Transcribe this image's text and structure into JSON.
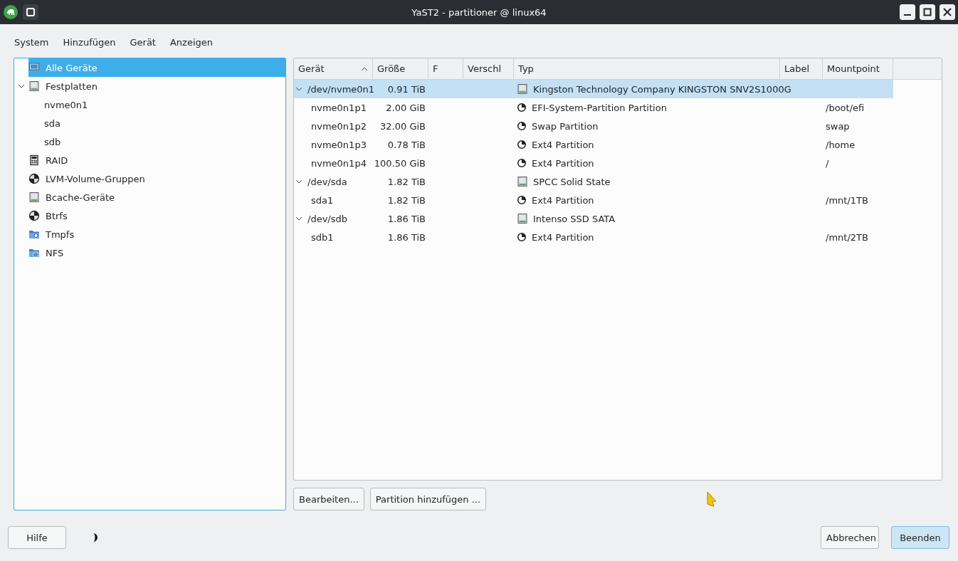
{
  "window": {
    "title": "YaST2 - partitioner @ linux64"
  },
  "menu": [
    "System",
    "Hinzufügen",
    "Gerät",
    "Anzeigen"
  ],
  "sidebar": {
    "items": [
      {
        "label": "Alle Geräte",
        "kind": "monitor",
        "selected": true
      },
      {
        "label": "Festplatten",
        "kind": "disk",
        "selected": false,
        "expanded": true,
        "children": [
          {
            "label": "nvme0n1",
            "selected": false
          },
          {
            "label": "sda",
            "selected": false
          },
          {
            "label": "sdb",
            "selected": false
          }
        ]
      },
      {
        "label": "RAID",
        "kind": "raid",
        "selected": false
      },
      {
        "label": "LVM-Volume-Gruppen",
        "kind": "pie",
        "selected": false
      },
      {
        "label": "Bcache-Geräte",
        "kind": "disk",
        "selected": false
      },
      {
        "label": "Btrfs",
        "kind": "pie",
        "selected": false
      },
      {
        "label": "Tmpfs",
        "kind": "folder",
        "selected": false
      },
      {
        "label": "NFS",
        "kind": "netfolder",
        "selected": false
      }
    ]
  },
  "table": {
    "columns": [
      {
        "label": "Gerät",
        "sorted": true
      },
      {
        "label": "Größe",
        "sorted": false
      },
      {
        "label": "F",
        "sorted": false
      },
      {
        "label": "Verschl",
        "sorted": false
      },
      {
        "label": "Typ",
        "sorted": false
      },
      {
        "label": "Label",
        "sorted": false
      },
      {
        "label": "Mountpoint",
        "sorted": false
      }
    ],
    "rows": [
      {
        "device": "/dev/nvme0n1",
        "size": "0.91 TiB",
        "type": "Kingston Technology Company KINGSTON SNV2S1000G",
        "kind": "disk",
        "selected": true,
        "expanded": true,
        "children": [
          {
            "device": "nvme0n1p1",
            "size": "2.00 GiB",
            "type": "EFI-System-Partition Partition",
            "kind": "partition",
            "mountpoint": "/boot/efi",
            "selected": false
          },
          {
            "device": "nvme0n1p2",
            "size": "32.00 GiB",
            "type": "Swap Partition",
            "kind": "partition",
            "mountpoint": "swap",
            "selected": false
          },
          {
            "device": "nvme0n1p3",
            "size": "0.78 TiB",
            "type": "Ext4 Partition",
            "kind": "partition",
            "mountpoint": "/home",
            "selected": false
          },
          {
            "device": "nvme0n1p4",
            "size": "100.50 GiB",
            "type": "Ext4 Partition",
            "kind": "partition",
            "mountpoint": "/",
            "selected": false
          }
        ]
      },
      {
        "device": "/dev/sda",
        "size": "1.82 TiB",
        "type": "SPCC Solid State",
        "kind": "disk",
        "selected": false,
        "expanded": true,
        "children": [
          {
            "device": "sda1",
            "size": "1.82 TiB",
            "type": "Ext4 Partition",
            "kind": "partition",
            "mountpoint": "/mnt/1TB",
            "selected": false
          }
        ]
      },
      {
        "device": "/dev/sdb",
        "size": "1.86 TiB",
        "type": "Intenso SSD SATA",
        "kind": "disk",
        "selected": false,
        "expanded": true,
        "children": [
          {
            "device": "sdb1",
            "size": "1.86 TiB",
            "type": "Ext4 Partition",
            "kind": "partition",
            "mountpoint": "/mnt/2TB",
            "selected": false
          }
        ]
      }
    ]
  },
  "table_buttons": [
    "Bearbeiten...",
    "Partition hinzufügen ..."
  ],
  "footer": {
    "help": "Hilfe",
    "cancel": "Abbrechen",
    "finish": "Beenden"
  }
}
